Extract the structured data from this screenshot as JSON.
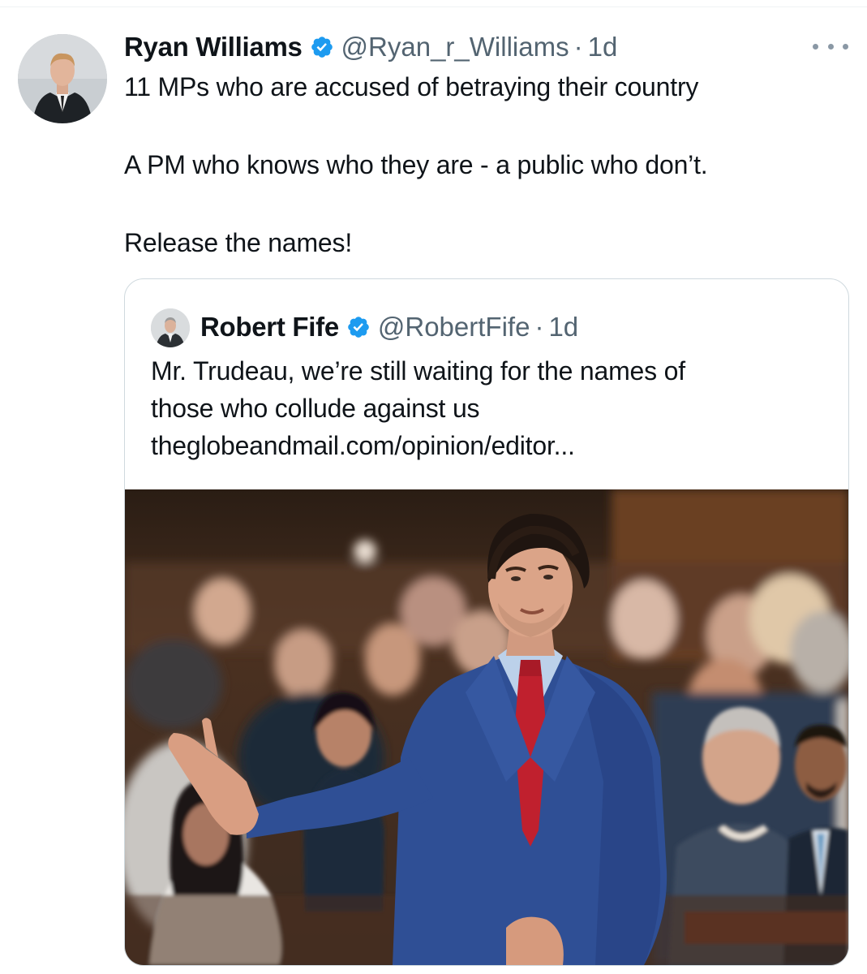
{
  "tweet": {
    "author_name": "Ryan Williams",
    "handle": "@Ryan_r_Williams",
    "separator": "·",
    "time_ago": "1d",
    "text_lines": [
      "11 MPs who are accused of betraying their country",
      "A PM who knows who they are - a public who don’t.",
      "Release the names!"
    ],
    "icons": {
      "verified": "verified-badge-icon",
      "more": "more-options-icon"
    },
    "colors": {
      "verified_badge": "#1d9bf0",
      "secondary_text": "#536471",
      "primary_text": "#0f1419",
      "card_border": "#cfd9de"
    }
  },
  "quote": {
    "author_name": "Robert Fife",
    "handle": "@RobertFife",
    "separator": "·",
    "time_ago": "1d",
    "text_lines": [
      "Mr. Trudeau, we’re still waiting for the names of",
      "those who collude against us",
      "theglobeandmail.com/opinion/editor..."
    ]
  }
}
